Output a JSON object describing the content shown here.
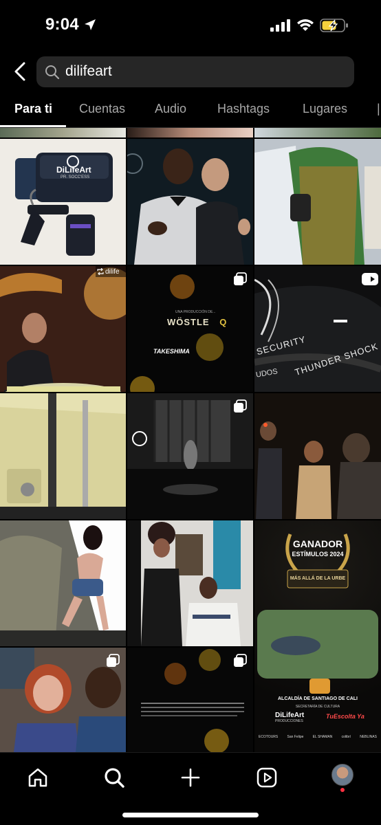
{
  "status_bar": {
    "time": "9:04"
  },
  "search": {
    "query": "dilifeart"
  },
  "tabs": [
    {
      "label": "Para ti",
      "active": true
    },
    {
      "label": "Cuentas",
      "active": false
    },
    {
      "label": "Audio",
      "active": false
    },
    {
      "label": "Hashtags",
      "active": false
    },
    {
      "label": "Lugares",
      "active": false
    }
  ],
  "grid": {
    "repost_username": "dilife",
    "posts": {
      "bag": {
        "brand": "DiLifeArt",
        "tagline": "PR. SOCC'ESS"
      },
      "film_credits": {
        "producer_line": "UNA PRODUCCIÓN DE...",
        "title": "WÖSTLE",
        "title_mark": "Q",
        "logo_text": "TAKESHIMA"
      },
      "tire": {
        "text_1": "SECURITY",
        "text_2": "THUNDER SHOCK",
        "text_3": "UDOS"
      },
      "award_poster": {
        "heading": "GANADOR",
        "subheading": "ESTÍMULOS 2024",
        "project": "MÁS ALLÁ DE LA URBE",
        "sponsor": "ALCALDÍA DE SANTIAGO DE CALI",
        "sponsor_sub": "SECRETARÍA DE CULTURA",
        "logo_1": "DiLifeArt",
        "logo_1_sub": "PRODUCCIONES",
        "logo_2": "TuEscolta Ya",
        "partner_1": "ECOTOURS",
        "partner_2": "San Felipe",
        "partner_3": "EL SHAMAN",
        "partner_4": "colibrí",
        "partner_5": "NEBLINAS"
      }
    }
  },
  "colors": {
    "background": "#000000",
    "search_bg": "#262626",
    "tab_inactive": "#a8a8a8",
    "award_gold": "#c9a44a",
    "notification": "#ff3040"
  },
  "nav": {
    "icons": [
      "home-icon",
      "search-icon",
      "create-icon",
      "reels-icon",
      "profile-avatar"
    ]
  }
}
